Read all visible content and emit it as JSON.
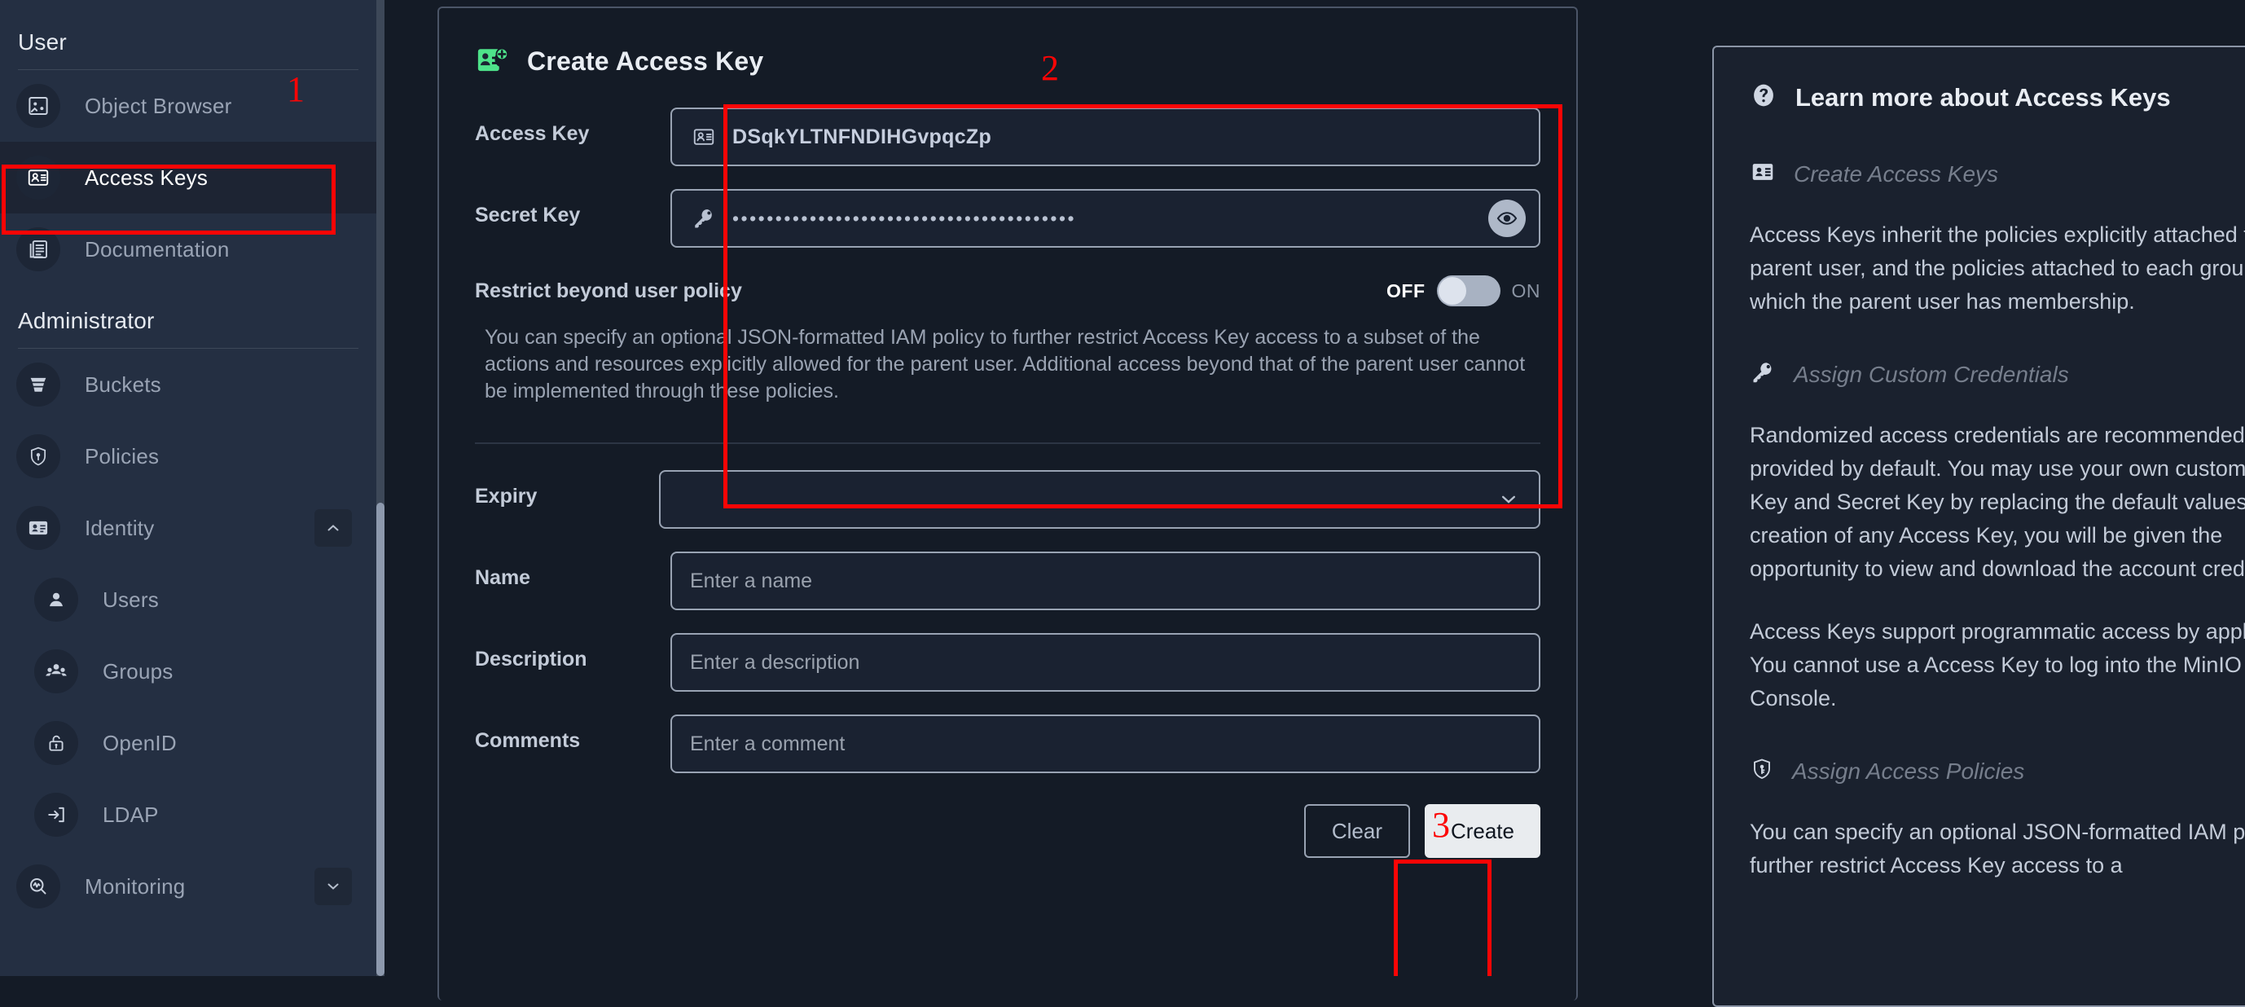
{
  "sidebar": {
    "sections": [
      {
        "title": "User",
        "items": [
          {
            "label": "Object Browser",
            "icon": "object-browser-icon",
            "active": false
          },
          {
            "label": "Access Keys",
            "icon": "access-keys-icon",
            "active": true
          },
          {
            "label": "Documentation",
            "icon": "documentation-icon",
            "active": false
          }
        ]
      },
      {
        "title": "Administrator",
        "items": [
          {
            "label": "Buckets",
            "icon": "bucket-icon",
            "active": false,
            "sub": false
          },
          {
            "label": "Policies",
            "icon": "policy-shield-icon",
            "active": false,
            "sub": false
          },
          {
            "label": "Identity",
            "icon": "identity-card-icon",
            "active": false,
            "sub": false,
            "expand": "chevron-up-icon"
          },
          {
            "label": "Users",
            "icon": "user-icon",
            "active": false,
            "sub": true
          },
          {
            "label": "Groups",
            "icon": "groups-icon",
            "active": false,
            "sub": true
          },
          {
            "label": "OpenID",
            "icon": "open-lock-icon",
            "active": false,
            "sub": true
          },
          {
            "label": "LDAP",
            "icon": "login-arrow-icon",
            "active": false,
            "sub": true
          },
          {
            "label": "Monitoring",
            "icon": "monitoring-icon",
            "active": false,
            "sub": false,
            "expand": "chevron-down-icon"
          }
        ]
      }
    ]
  },
  "page": {
    "title": "Create Access Key",
    "title_icon": "create-access-key-icon"
  },
  "form": {
    "access_key": {
      "label": "Access Key",
      "icon": "id-card-icon",
      "value": "DSqkYLTNFNDIHGvpqcZp"
    },
    "secret_key": {
      "label": "Secret Key",
      "icon": "key-icon",
      "masked_value": "••••••••••••••••••••••••••••••••••••••••",
      "reveal_icon": "eye-icon"
    },
    "restrict": {
      "label": "Restrict beyond user policy",
      "toggle_off_label": "OFF",
      "toggle_on_label": "ON",
      "toggle_state": "OFF",
      "description": "You can specify an optional JSON-formatted IAM policy to further restrict Access Key access to a subset of the actions and resources explicitly allowed for the parent user. Additional access beyond that of the parent user cannot be implemented through these policies."
    },
    "expiry": {
      "label": "Expiry",
      "value": "",
      "chevron_icon": "chevron-down-icon"
    },
    "name": {
      "label": "Name",
      "value": "",
      "placeholder": "Enter a name"
    },
    "description": {
      "label": "Description",
      "value": "",
      "placeholder": "Enter a description"
    },
    "comments": {
      "label": "Comments",
      "value": "",
      "placeholder": "Enter a comment"
    },
    "buttons": {
      "clear": "Clear",
      "create": "Create"
    }
  },
  "help": {
    "title": "Learn more about Access Keys",
    "title_icon": "question-circle-icon",
    "sections": [
      {
        "heading": "Create Access Keys",
        "icon": "id-card-icon",
        "paragraphs": [
          "Access Keys inherit the policies explicitly attached to the parent user, and the policies attached to each group in which the parent user has membership."
        ]
      },
      {
        "heading": "Assign Custom Credentials",
        "icon": "key-icon",
        "paragraphs": [
          "Randomized access credentials are recommended, and provided by default. You may use your own custom Access Key and Secret Key by replacing the default values. After creation of any Access Key, you will be given the opportunity to view and download the account credentials.",
          "Access Keys support programmatic access by applications. You cannot use a Access Key to log into the MinIO Console."
        ]
      },
      {
        "heading": "Assign Access Policies",
        "icon": "shield-key-icon",
        "paragraphs": [
          "You can specify an optional JSON-formatted IAM policy to further restrict Access Key access to a"
        ]
      }
    ]
  },
  "annotations": [
    {
      "number": "1",
      "target": "sidebar-item-access-keys"
    },
    {
      "number": "2",
      "target": "credentials-group"
    },
    {
      "number": "3",
      "target": "create-button"
    }
  ],
  "colors": {
    "accent_green": "#4ee38a",
    "annotation_red": "#fc0505",
    "sidebar_bg": "#242f42",
    "content_bg": "#141b26"
  }
}
